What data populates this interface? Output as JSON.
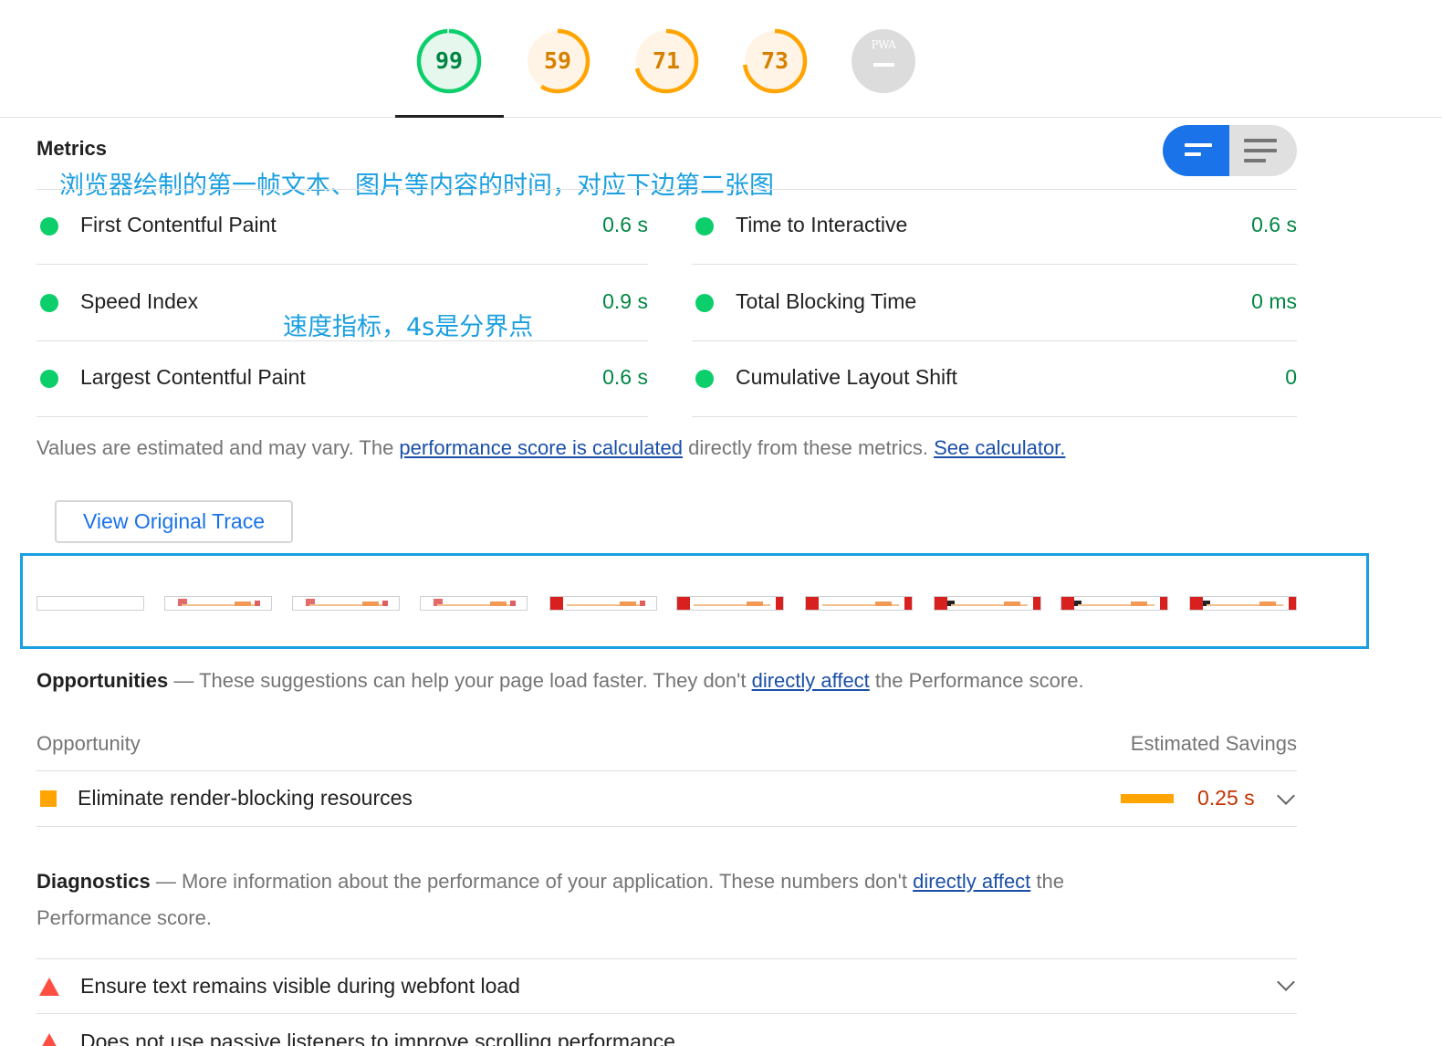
{
  "colors": {
    "pass": "#0cce6b",
    "average": "#ffa400",
    "fail": "#ff4e42",
    "link": "#1a4fa8",
    "annotation": "#1a9fe0",
    "toggle_active": "#1a73e8"
  },
  "scores": [
    {
      "name": "score-performance",
      "value": "99",
      "level": "pass",
      "fraction": 0.99
    },
    {
      "name": "score-accessibility",
      "value": "59",
      "level": "average",
      "fraction": 0.59
    },
    {
      "name": "score-best-practices",
      "value": "71",
      "level": "average",
      "fraction": 0.71
    },
    {
      "name": "score-seo",
      "value": "73",
      "level": "average",
      "fraction": 0.73
    },
    {
      "name": "score-pwa",
      "value": "PWA",
      "level": "na",
      "fraction": 0
    }
  ],
  "metrics": {
    "title": "Metrics",
    "annotation_1": "浏览器绘制的第一帧文本、图片等内容的时间，对应下边第二张图",
    "annotation_2": "速度指标，4s是分界点",
    "items": [
      {
        "label": "First Contentful Paint",
        "value": "0.6 s"
      },
      {
        "label": "Time to Interactive",
        "value": "0.6 s"
      },
      {
        "label": "Speed Index",
        "value": "0.9 s"
      },
      {
        "label": "Total Blocking Time",
        "value": "0 ms"
      },
      {
        "label": "Largest Contentful Paint",
        "value": "0.6 s"
      },
      {
        "label": "Cumulative Layout Shift",
        "value": "0"
      }
    ],
    "note_prefix": "Values are estimated and may vary. The ",
    "note_link_1": "performance score is calculated",
    "note_middle": " directly from these metrics. ",
    "note_link_2": "See calculator."
  },
  "trace_button": "View Original Trace",
  "opportunities": {
    "title": "Opportunities",
    "dash": " — ",
    "desc_prefix": "These suggestions can help your page load faster. They don't ",
    "desc_link": "directly affect",
    "desc_suffix": " the Performance score.",
    "col_opportunity": "Opportunity",
    "col_savings": "Estimated Savings",
    "items": [
      {
        "label": "Eliminate render-blocking resources",
        "savings": "0.25 s"
      }
    ]
  },
  "diagnostics": {
    "title": "Diagnostics",
    "dash": " — ",
    "desc_prefix": "More information about the performance of your application. These numbers don't ",
    "desc_link": "directly affect",
    "desc_suffix": " the",
    "desc_line2": "Performance score.",
    "items": [
      {
        "label": "Ensure text remains visible during webfont load"
      },
      {
        "label": "Does not use passive listeners to improve scrolling performance"
      }
    ]
  }
}
